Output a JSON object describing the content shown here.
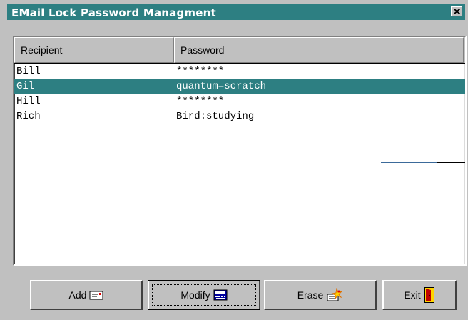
{
  "window": {
    "title": "EMail Lock Password Managment",
    "title_bar_color": "#2d7f82"
  },
  "list": {
    "columns": [
      "Recipient",
      "Password"
    ],
    "rows": [
      {
        "recipient": "Bill",
        "password": "********",
        "selected": false
      },
      {
        "recipient": "Gil",
        "password": "quantum=scratch",
        "selected": true
      },
      {
        "recipient": "Hill",
        "password": "********",
        "selected": false
      },
      {
        "recipient": "Rich",
        "password": "Bird:studying",
        "selected": false
      }
    ],
    "selection_color": "#2d7f82"
  },
  "buttons": {
    "add": {
      "label": "Add",
      "icon": "envelope-icon"
    },
    "modify": {
      "label": "Modify",
      "icon": "keyboard-icon"
    },
    "erase": {
      "label": "Erase",
      "icon": "eraser-sparkle-icon"
    },
    "exit": {
      "label": "Exit",
      "icon": "door-exit-icon"
    }
  }
}
